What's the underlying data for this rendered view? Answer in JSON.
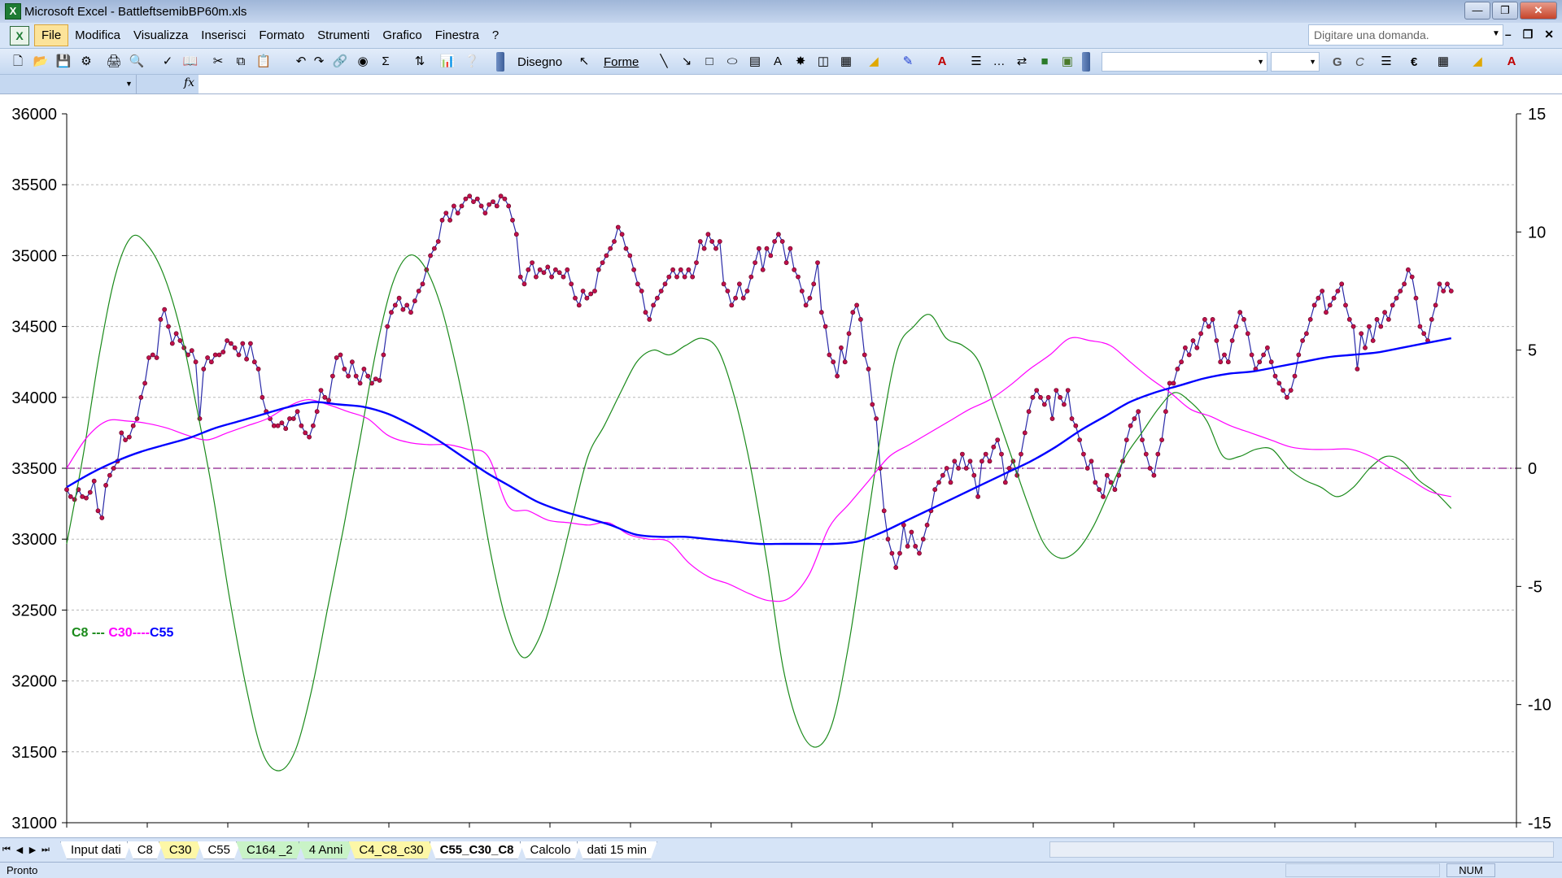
{
  "window": {
    "title": "Microsoft Excel - BattleftsemibBP60m.xls",
    "app_icon": "excel-icon"
  },
  "menu": {
    "items": [
      "File",
      "Modifica",
      "Visualizza",
      "Inserisci",
      "Formato",
      "Strumenti",
      "Grafico",
      "Finestra",
      "?"
    ],
    "active": "File",
    "ask_placeholder": "Digitare una domanda."
  },
  "toolbar": {
    "draw_label": "Disegno",
    "shapes_label": "Forme",
    "bold_label": "G",
    "italic_label": "C",
    "euro_label": "€"
  },
  "formula_bar": {
    "name_box": "",
    "fx_label": "fx"
  },
  "chart_data": {
    "type": "line",
    "legend": {
      "c8": "C8 ---",
      "c30": " C30----",
      "c55": "C55",
      "colors": {
        "c8": "#1a8a1a",
        "c30": "#ff00ff",
        "c55": "#0000ff"
      }
    },
    "y_left": {
      "min": 31000,
      "max": 36000,
      "ticks": [
        "36000",
        "35500",
        "35000",
        "34500",
        "34000",
        "33500",
        "33000",
        "32500",
        "32000",
        "31500",
        "31000"
      ]
    },
    "y_right": {
      "min": -15,
      "max": 15,
      "ticks": [
        "15",
        "10",
        "5",
        "0",
        "-5",
        "-10",
        "-15"
      ]
    },
    "zero_line": 0,
    "series": [
      {
        "color": "#2a2aa8",
        "marker_color": "#c0104a",
        "axis": "left",
        "values": [
          33350,
          33300,
          33280,
          33350,
          33300,
          33290,
          33330,
          33410,
          33200,
          33150,
          33380,
          33450,
          33500,
          33550,
          33750,
          33700,
          33720,
          33800,
          33850,
          34000,
          34100,
          34280,
          34300,
          34280,
          34550,
          34620,
          34500,
          34380,
          34450,
          34400,
          34350,
          34300,
          34330,
          34250,
          33850,
          34200,
          34280,
          34250,
          34300,
          34300,
          34320,
          34400,
          34380,
          34350,
          34300,
          34380,
          34270,
          34380,
          34250,
          34200,
          34000,
          33900,
          33850,
          33800,
          33800,
          33820,
          33780,
          33850,
          33850,
          33900,
          33800,
          33750,
          33720,
          33800,
          33900,
          34050,
          34000,
          33980,
          34150,
          34280,
          34300,
          34200,
          34150,
          34250,
          34150,
          34100,
          34200,
          34150,
          34100,
          34130,
          34120,
          34300,
          34500,
          34600,
          34650,
          34700,
          34620,
          34650,
          34600,
          34680,
          34750,
          34800,
          34900,
          35000,
          35050,
          35100,
          35250,
          35300,
          35250,
          35350,
          35300,
          35350,
          35400,
          35420,
          35380,
          35400,
          35350,
          35300,
          35360,
          35380,
          35350,
          35420,
          35400,
          35350,
          35250,
          35150,
          34850,
          34800,
          34900,
          34950,
          34850,
          34900,
          34880,
          34920,
          34850,
          34900,
          34880,
          34850,
          34900,
          34800,
          34700,
          34650,
          34750,
          34700,
          34730,
          34750,
          34900,
          34950,
          35000,
          35050,
          35100,
          35200,
          35150,
          35050,
          35000,
          34900,
          34800,
          34750,
          34600,
          34550,
          34650,
          34700,
          34750,
          34800,
          34850,
          34900,
          34850,
          34900,
          34850,
          34900,
          34850,
          34950,
          35100,
          35050,
          35150,
          35100,
          35050,
          35100,
          34800,
          34750,
          34650,
          34700,
          34800,
          34700,
          34750,
          34850,
          34950,
          35050,
          34900,
          35050,
          35000,
          35100,
          35150,
          35100,
          34950,
          35050,
          34900,
          34850,
          34750,
          34650,
          34700,
          34800,
          34950,
          34600,
          34500,
          34300,
          34250,
          34150,
          34350,
          34250,
          34450,
          34600,
          34650,
          34550,
          34300,
          34200,
          33950,
          33850,
          33500,
          33200,
          33000,
          32900,
          32800,
          32900,
          33100,
          32950,
          33050,
          32950,
          32900,
          33000,
          33100,
          33200,
          33350,
          33400,
          33450,
          33500,
          33400,
          33550,
          33500,
          33600,
          33500,
          33550,
          33450,
          33300,
          33550,
          33600,
          33550,
          33650,
          33700,
          33600,
          33400,
          33500,
          33550,
          33450,
          33600,
          33750,
          33900,
          34000,
          34050,
          34000,
          33950,
          34000,
          33850,
          34050,
          34000,
          33950,
          34050,
          33850,
          33800,
          33700,
          33600,
          33500,
          33550,
          33400,
          33350,
          33300,
          33450,
          33400,
          33350,
          33450,
          33550,
          33700,
          33800,
          33850,
          33900,
          33700,
          33600,
          33500,
          33450,
          33600,
          33700,
          33900,
          34100,
          34100,
          34200,
          34250,
          34350,
          34300,
          34400,
          34350,
          34450,
          34550,
          34500,
          34550,
          34400,
          34250,
          34300,
          34250,
          34400,
          34500,
          34600,
          34550,
          34450,
          34300,
          34200,
          34250,
          34300,
          34350,
          34250,
          34150,
          34100,
          34050,
          34000,
          34050,
          34150,
          34300,
          34400,
          34450,
          34550,
          34650,
          34700,
          34750,
          34600,
          34650,
          34700,
          34750,
          34800,
          34650,
          34550,
          34500,
          34200,
          34450,
          34350,
          34500,
          34400,
          34550,
          34500,
          34600,
          34550,
          34650,
          34700,
          34750,
          34800,
          34900,
          34850,
          34700,
          34500,
          34450,
          34400,
          34550,
          34650,
          34800,
          34750,
          34800,
          34750
        ]
      },
      {
        "color": "#1a8a1a",
        "axis": "right",
        "width": 1.2,
        "values": [
          -3.2,
          0.5,
          4.8,
          8.2,
          9.8,
          9.4,
          8.1,
          5.8,
          2.5,
          -1.2,
          -5.5,
          -9.2,
          -12.0,
          -12.8,
          -12.0,
          -9.5,
          -6.0,
          -2.5,
          1.2,
          5.0,
          7.8,
          9.0,
          8.5,
          6.8,
          4.0,
          0.5,
          -3.5,
          -6.5,
          -8.0,
          -7.2,
          -5.0,
          -2.2,
          0.5,
          1.8,
          3.2,
          4.5,
          5.0,
          4.8,
          5.2,
          5.5,
          5.0,
          3.0,
          0.0,
          -4.0,
          -8.5,
          -11.0,
          -11.8,
          -10.8,
          -7.5,
          -3.0,
          1.5,
          5.0,
          6.0,
          6.5,
          5.5,
          5.2,
          4.5,
          2.5,
          0.5,
          -1.5,
          -3.2,
          -3.8,
          -3.5,
          -2.5,
          -1.0,
          0.5,
          1.5,
          2.5,
          3.2,
          2.8,
          2.0,
          0.5,
          0.5,
          0.8,
          0.8,
          0.0,
          -0.5,
          -0.8,
          -1.2,
          -0.8,
          0.0,
          0.5,
          0.3,
          -0.5,
          -1.0,
          -1.7
        ],
        "x_start_frac": 0.0,
        "x_end_frac": 0.955
      },
      {
        "color": "#ff00ff",
        "axis": "right",
        "width": 1.2,
        "values": [
          0.0,
          1.3,
          2.0,
          2.0,
          1.9,
          1.7,
          1.4,
          1.2,
          1.5,
          1.8,
          2.1,
          2.6,
          2.9,
          2.7,
          2.4,
          2.1,
          1.4,
          1.1,
          1.0,
          1.0,
          0.8,
          0.5,
          -1.6,
          -1.8,
          -2.2,
          -2.3,
          -2.4,
          -2.3,
          -2.8,
          -3.0,
          -3.1,
          -4.0,
          -4.6,
          -4.9,
          -5.3,
          -5.6,
          -5.5,
          -4.5,
          -2.5,
          -1.5,
          -0.5,
          0.5,
          1.0,
          1.5,
          2.0,
          2.5,
          2.9,
          3.5,
          4.2,
          4.8,
          5.5,
          5.4,
          5.2,
          4.5,
          3.8,
          3.2,
          2.5,
          2.2,
          1.8,
          1.5,
          1.2,
          0.9,
          0.8,
          0.8,
          0.8,
          0.5,
          0.0,
          -0.5,
          -1.0,
          -1.2
        ],
        "x_start_frac": 0.0,
        "x_end_frac": 0.955
      },
      {
        "color": "#0000ff",
        "axis": "right",
        "width": 2.4,
        "values": [
          -0.8,
          -0.2,
          0.3,
          0.7,
          1.0,
          1.3,
          1.7,
          2.0,
          2.3,
          2.6,
          2.8,
          2.7,
          2.6,
          2.3,
          1.8,
          1.2,
          0.5,
          -0.2,
          -0.8,
          -1.4,
          -1.8,
          -2.1,
          -2.4,
          -2.8,
          -2.9,
          -2.9,
          -3.0,
          -3.1,
          -3.2,
          -3.2,
          -3.2,
          -3.2,
          -3.1,
          -2.7,
          -2.2,
          -1.7,
          -1.2,
          -0.7,
          -0.2,
          0.3,
          0.9,
          1.6,
          2.2,
          2.8,
          3.2,
          3.5,
          3.8,
          4.0,
          4.1,
          4.3,
          4.5,
          4.7,
          4.8,
          4.9,
          5.1,
          5.3,
          5.5
        ],
        "x_start_frac": 0.0,
        "x_end_frac": 0.955
      }
    ]
  },
  "sheet_tabs": {
    "tabs": [
      "Input dati",
      "C8",
      "C30",
      "C55",
      "C164 _2",
      "4 Anni",
      "C4_C8_c30",
      "C55_C30_C8",
      "Calcolo",
      "dati 15 min"
    ],
    "styles": [
      "",
      "",
      "yellow",
      "",
      "green",
      "green",
      "yellow",
      "active",
      "",
      ""
    ],
    "active": "C55_C30_C8"
  },
  "status_bar": {
    "status": "Pronto",
    "num": "NUM"
  }
}
